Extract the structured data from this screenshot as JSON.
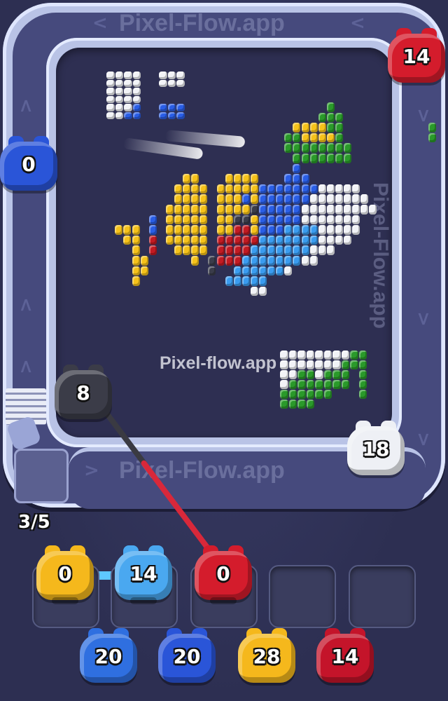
{
  "watermark": {
    "top": "Pixel-Flow.app",
    "bottom": "Pixel-Flow.app",
    "side": "Pixel-Flow.app",
    "center": "Pixel-flow.app"
  },
  "queue_counter": "3/5",
  "shooters_on_track": [
    {
      "id": "red-top-right",
      "color": "#d41c2c",
      "count": "14"
    },
    {
      "id": "blue-left",
      "color": "#2a55d8",
      "count": "0"
    },
    {
      "id": "black-left",
      "color": "#3b3c48",
      "count": "8"
    },
    {
      "id": "white-right",
      "color": "#eef0f5",
      "count": "18"
    }
  ],
  "slots": [
    {
      "filled": true,
      "color": "#f5b81c",
      "count": "0"
    },
    {
      "filled": true,
      "color": "#4aa8f0",
      "count": "14"
    },
    {
      "filled": true,
      "color": "#d41c2c",
      "count": "0"
    },
    {
      "filled": false
    },
    {
      "filled": false
    }
  ],
  "queue": [
    {
      "color": "#2f6fe0",
      "count": "20"
    },
    {
      "color": "#2a55d8",
      "count": "20"
    },
    {
      "color": "#f5b81c",
      "count": "28"
    },
    {
      "color": "#c4142a",
      "count": "14"
    }
  ],
  "pixel_colors": {
    "W": "#f2f3f7",
    "B": "#2a5ee6",
    "L": "#3a9cf0",
    "Y": "#f6c21a",
    "O": "#f29a12",
    "R": "#c21a22",
    "G": "#2a9a2a",
    "K": "#3a3c4a"
  },
  "pixel_art": {
    "topleft": [
      "WWWW  WWW",
      "WWWW  WWW",
      "WWWW     ",
      "WWWW     ",
      "WWWB  BBB",
      "WWBB  BBB"
    ],
    "main": [
      "                            G                    ",
      "                           GGG                   ",
      "                        YYYYGG          G        ",
      "                       GGYYYYG          G        ",
      "                       GGGGGGGG                 ",
      "                        GGGGGGG                 ",
      "                        B                       ",
      "           YY   YYYY   BBB                      ",
      "          YYYY YYYYYBBBBBBBWWWWW                 ",
      "          YYYY YYYBYBBBBBBWWWWWWW                ",
      "         YYYYY YYYYKBBBBBWWWWWWWWW               ",
      "       B YYYYY YYKKYBBBBBWWWWWWW                 ",
      "   YYY B YYYYY YYRRYBBBLLLLWWWWW                 ",
      "    YY R YYYYY RRRRRLLLLLLLWWWW                  ",
      "     Y R  YYYY RRRRLLLLLLLWWW                    ",
      "     YY     Y KRRRLLLLLLLWW                      ",
      "     YY       K  LLLLLLW                         ",
      "     Y          LLLLL                            ",
      "                   WW                            "
    ],
    "bottomright": [
      "WWWWWWWWGG",
      "WWWWWWWGGG",
      "WWGGWGGG G",
      "WGGGGGGG G",
      "GGGGGG   G",
      "GGGG      "
    ]
  }
}
